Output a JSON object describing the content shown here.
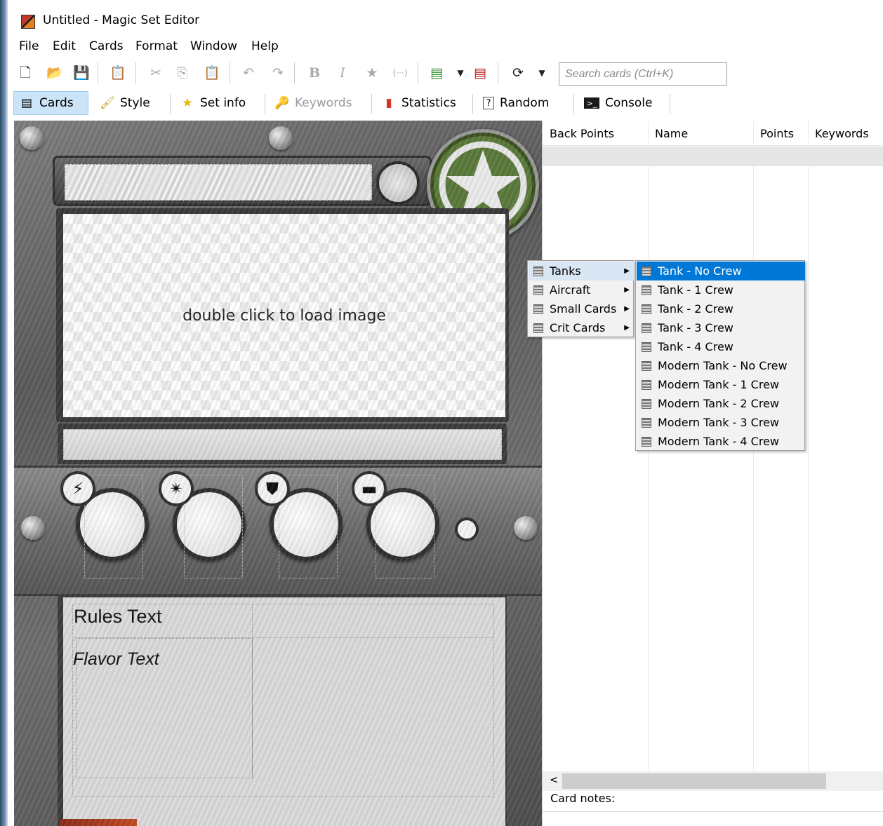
{
  "window": {
    "title": "Untitled - Magic Set Editor"
  },
  "menubar": [
    "File",
    "Edit",
    "Cards",
    "Format",
    "Window",
    "Help"
  ],
  "toolbar": {
    "search_placeholder": "Search cards (Ctrl+K)"
  },
  "tabs": [
    {
      "label": "Cards",
      "icon": "card-icon",
      "active": true
    },
    {
      "label": "Style",
      "icon": "brush-icon"
    },
    {
      "label": "Set info",
      "icon": "star-icon"
    },
    {
      "label": "Keywords",
      "icon": "key-icon",
      "disabled": true
    },
    {
      "label": "Statistics",
      "icon": "bar-chart-icon"
    },
    {
      "label": "Random",
      "icon": "question-icon"
    },
    {
      "label": "Console",
      "icon": "console-icon"
    }
  ],
  "card": {
    "image_prompt": "double click to load image",
    "rules_text": "Rules Text",
    "flavor_text": "Flavor Text"
  },
  "card_list": {
    "columns": [
      "Back Points",
      "Name",
      "Points",
      "Keywords"
    ]
  },
  "card_notes_label": "Card notes:",
  "context_menu": {
    "items": [
      "Tanks",
      "Aircraft",
      "Small Cards",
      "Crit Cards"
    ],
    "submenu": [
      "Tank - No Crew",
      "Tank - 1 Crew",
      "Tank - 2 Crew",
      "Tank - 3 Crew",
      "Tank - 4 Crew",
      "Modern Tank - No Crew",
      "Modern Tank - 1 Crew",
      "Modern Tank - 2 Crew",
      "Modern Tank - 3 Crew",
      "Modern Tank - 4 Crew"
    ],
    "highlighted": "Tank - No Crew",
    "highlight_color": "#0078d7"
  }
}
